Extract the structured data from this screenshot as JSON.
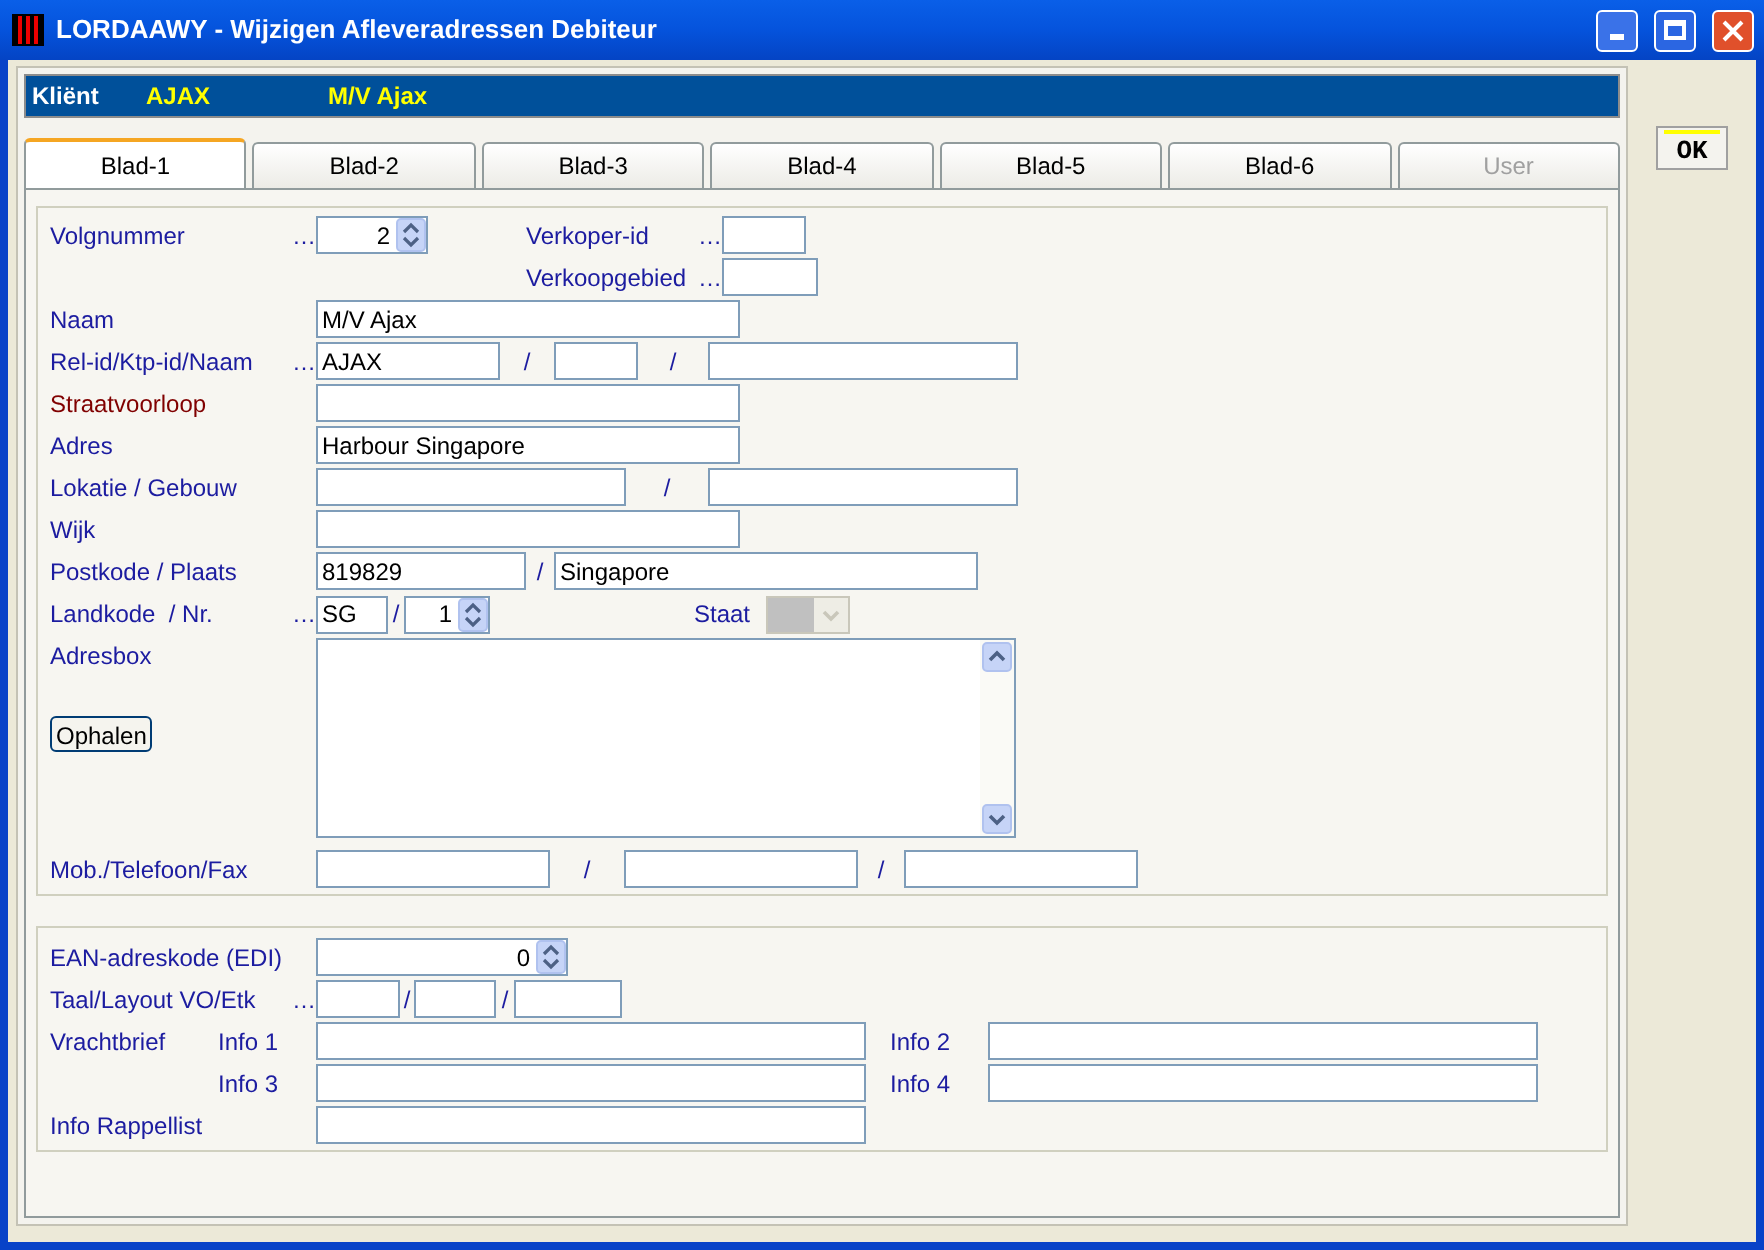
{
  "window": {
    "title": "LORDAAWY - Wijzigen Afleveradressen Debiteur"
  },
  "client_bar": {
    "label": "Kliënt",
    "code": "AJAX",
    "name": "M/V Ajax"
  },
  "tabs": [
    {
      "label": "Blad-1",
      "selected": true,
      "disabled": false
    },
    {
      "label": "Blad-2",
      "selected": false,
      "disabled": false
    },
    {
      "label": "Blad-3",
      "selected": false,
      "disabled": false
    },
    {
      "label": "Blad-4",
      "selected": false,
      "disabled": false
    },
    {
      "label": "Blad-5",
      "selected": false,
      "disabled": false
    },
    {
      "label": "Blad-6",
      "selected": false,
      "disabled": false
    },
    {
      "label": "User",
      "selected": false,
      "disabled": true
    }
  ],
  "ok_button": "OK",
  "address": {
    "volgnummer": {
      "label": "Volgnummer",
      "lookup": "…",
      "value": "2",
      "emphasis": false
    },
    "verkoper_id": {
      "label": "Verkoper-id",
      "lookup": "…"
    },
    "verkoopgebied": {
      "label": "Verkoopgebied",
      "lookup": "…"
    },
    "naam": {
      "label": "Naam",
      "values": [
        "M/V Ajax"
      ],
      "emphasis": false
    },
    "rel": {
      "label": "Rel-id/Ktp-id/Naam",
      "lookup": "…",
      "values": [
        "AJAX"
      ],
      "separators": [
        "/",
        "/"
      ],
      "emphasis": false
    },
    "straatvoorloop": {
      "label": "Straatvoorloop",
      "emphasis": true
    },
    "adres": {
      "label": "Adres",
      "values": [
        "Harbour Singapore"
      ],
      "emphasis": false
    },
    "lokatie": {
      "label": "Lokatie / Gebouw",
      "separators": [
        "/"
      ],
      "emphasis": false
    },
    "wijk": {
      "label": "Wijk",
      "emphasis": false
    },
    "postkode": {
      "label": "Postkode / Plaats",
      "values": [
        "819829",
        "Singapore"
      ],
      "separators": [
        "/"
      ],
      "emphasis": false
    },
    "landkode": {
      "label": "Landkode  / Nr.",
      "lookup": "…",
      "values": [
        "SG",
        "1"
      ],
      "separators": [
        "/"
      ],
      "emphasis": false
    },
    "staat": {
      "label": "Staat",
      "disabled": true
    },
    "adresbox": {
      "label": "Adresbox",
      "button": "Ophalen"
    },
    "telefoon": {
      "label": "Mob./Telefoon/Fax",
      "separators": [
        "/",
        "/"
      ],
      "emphasis": false
    }
  },
  "extra": {
    "ean": {
      "label": "EAN-adreskode (EDI)",
      "value": "0"
    },
    "taal": {
      "label": "Taal/Layout VO/Etk",
      "lookup": "…",
      "separators": [
        "/",
        "/"
      ]
    },
    "vrachtbrief": {
      "label": "Vrachtbrief",
      "info_labels": [
        "Info 1",
        "Info 2",
        "Info 3",
        "Info 4"
      ]
    },
    "rappellist": {
      "label": "Info Rappellist"
    }
  }
}
